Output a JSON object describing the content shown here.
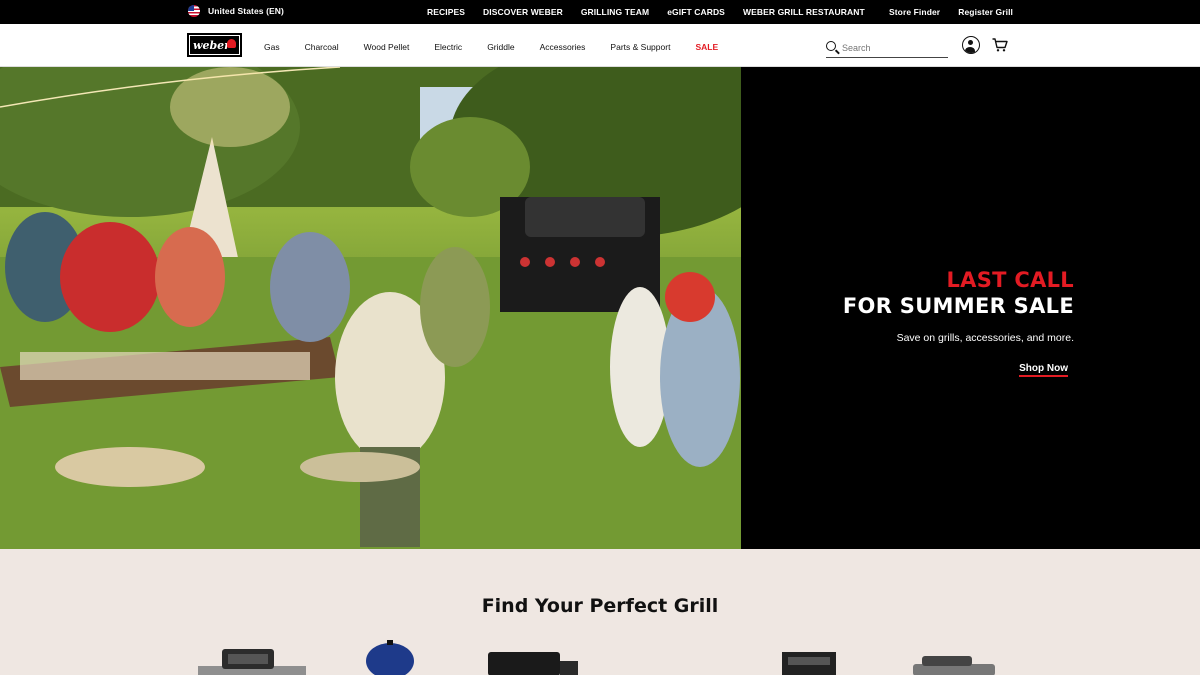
{
  "utility": {
    "locale": "United States  (EN)",
    "links": [
      "RECIPES",
      "DISCOVER WEBER",
      "GRILLING TEAM",
      "eGIFT CARDS",
      "WEBER GRILL RESTAURANT"
    ],
    "store_finder": "Store Finder",
    "register_grill": "Register Grill"
  },
  "nav": {
    "logo_text": "weber",
    "items": [
      "Gas",
      "Charcoal",
      "Wood Pellet",
      "Electric",
      "Griddle",
      "Accessories",
      "Parts & Support",
      "SALE"
    ],
    "sale_color": "#e31b23",
    "search_placeholder": "Search"
  },
  "hero": {
    "line1": "LAST CALL",
    "line2": "FOR SUMMER SALE",
    "subtitle": "Save on grills, accessories, and more.",
    "cta": "Shop Now",
    "accent_color": "#e31b23"
  },
  "finder": {
    "title": "Find Your Perfect Grill",
    "products": [
      "gas-grill",
      "kettle-grill",
      "pellet-grill",
      "electric-grill",
      "griddle"
    ]
  }
}
